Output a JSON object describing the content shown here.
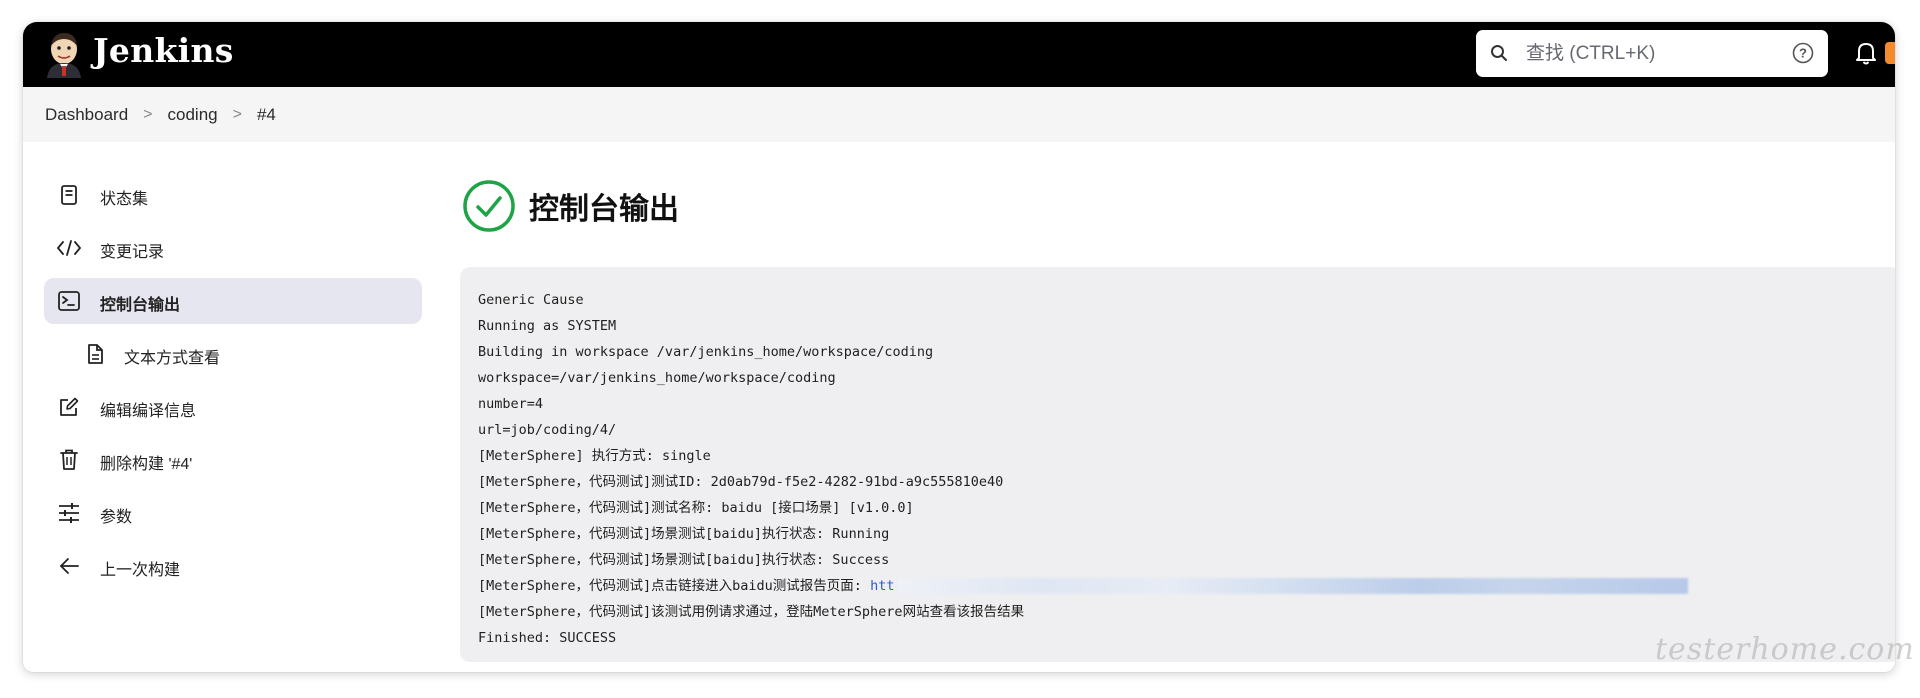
{
  "app": {
    "brand": "Jenkins"
  },
  "search": {
    "placeholder": "查找 (CTRL+K)"
  },
  "breadcrumb": [
    "Dashboard",
    "coding",
    "#4"
  ],
  "sidebar": {
    "items": [
      {
        "label": "状态集",
        "icon": "status-icon",
        "active": false
      },
      {
        "label": "变更记录",
        "icon": "code-icon",
        "active": false
      },
      {
        "label": "控制台输出",
        "icon": "terminal-icon",
        "active": true
      },
      {
        "label": "文本方式查看",
        "icon": "document-icon",
        "active": false,
        "sub": true
      },
      {
        "label": "编辑编译信息",
        "icon": "edit-icon",
        "active": false
      },
      {
        "label": "删除构建 '#4'",
        "icon": "trash-icon",
        "active": false
      },
      {
        "label": "参数",
        "icon": "sliders-icon",
        "active": false
      },
      {
        "label": "上一次构建",
        "icon": "arrow-left-icon",
        "active": false
      }
    ]
  },
  "main": {
    "title": "控制台输出",
    "status": "success",
    "console_lines": [
      "Generic Cause",
      "Running as SYSTEM",
      "Building in workspace /var/jenkins_home/workspace/coding",
      "workspace=/var/jenkins_home/workspace/coding",
      "number=4",
      "url=job/coding/4/",
      "[MeterSphere] 执行方式: single",
      "[MeterSphere，代码测试]测试ID: 2d0ab79d-f5e2-4282-91bd-a9c555810e40",
      "[MeterSphere，代码测试]测试名称: baidu [接口场景] [v1.0.0]",
      "[MeterSphere，代码测试]场景测试[baidu]执行状态: Running",
      "[MeterSphere，代码测试]场景测试[baidu]执行状态: Success",
      "[MeterSphere，代码测试]点击链接进入baidu测试报告页面: ",
      "[MeterSphere，代码测试]该测试用例请求通过，登陆MeterSphere网站查看该报告结果",
      "Finished: SUCCESS"
    ],
    "report_link": "htt"
  },
  "watermark": "testerhome.com",
  "colors": {
    "header_bg": "#000000",
    "success_green": "#1ea446",
    "link_blue": "#2a5bd7",
    "active_bg": "#e6e6f0"
  }
}
